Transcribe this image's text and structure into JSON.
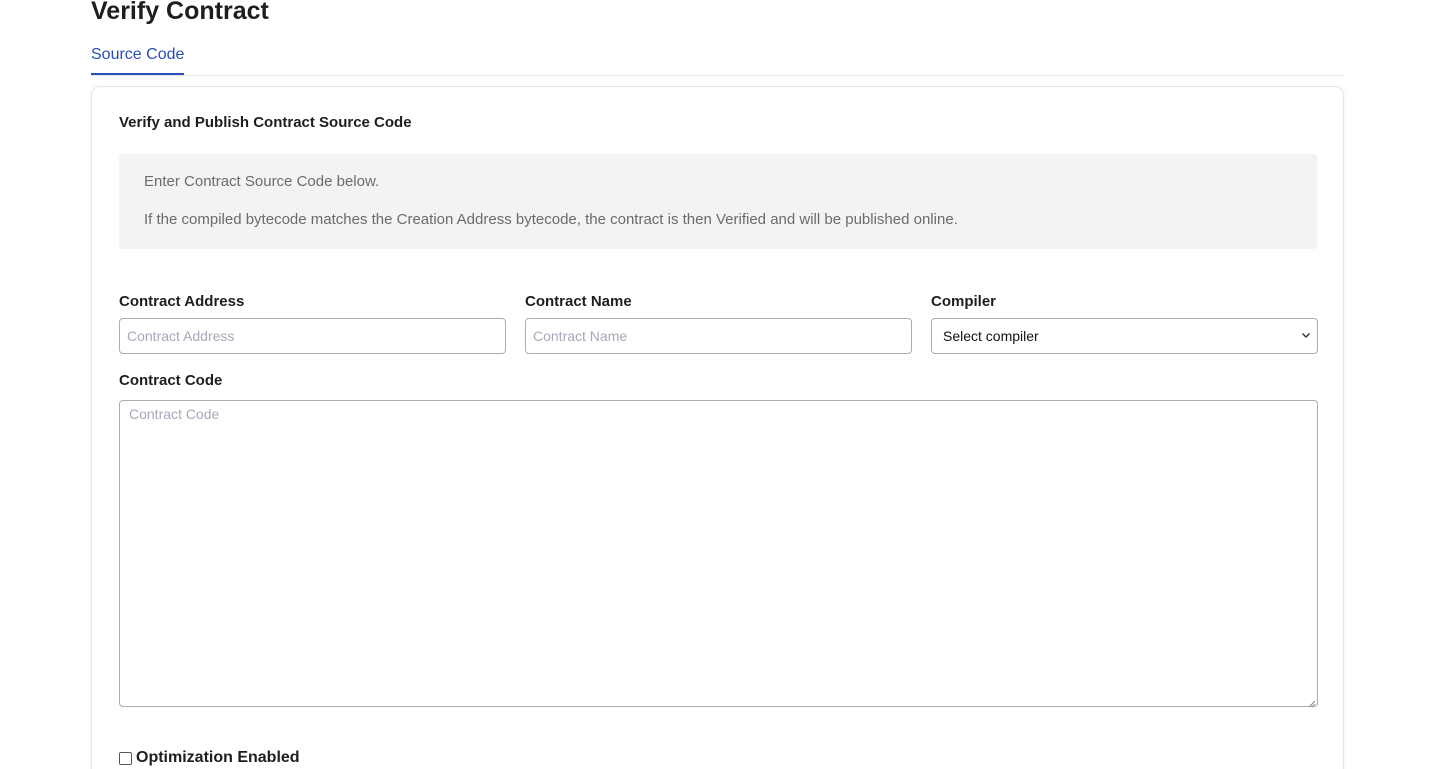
{
  "page": {
    "title": "Verify Contract"
  },
  "tabs": [
    {
      "label": "Source Code",
      "active": true
    }
  ],
  "card": {
    "title": "Verify and Publish Contract Source Code",
    "info_lines": [
      "Enter Contract Source Code below.",
      "If the compiled bytecode matches the Creation Address bytecode, the contract is then Verified and will be published online."
    ]
  },
  "form": {
    "contract_address": {
      "label": "Contract Address",
      "placeholder": "Contract Address",
      "value": ""
    },
    "contract_name": {
      "label": "Contract Name",
      "placeholder": "Contract Name",
      "value": ""
    },
    "compiler": {
      "label": "Compiler",
      "selected": "Select compiler"
    },
    "contract_code": {
      "label": "Contract Code",
      "placeholder": "Contract Code",
      "value": ""
    },
    "optimization": {
      "label": "Optimization Enabled",
      "checked": false
    }
  },
  "colors": {
    "accent": "#2b4fb8",
    "info_bg": "#f3f3f3",
    "border": "#a9adb4"
  },
  "icons": {
    "select_chevron": "chevron-down-icon",
    "resize": "resize-grip-icon"
  }
}
